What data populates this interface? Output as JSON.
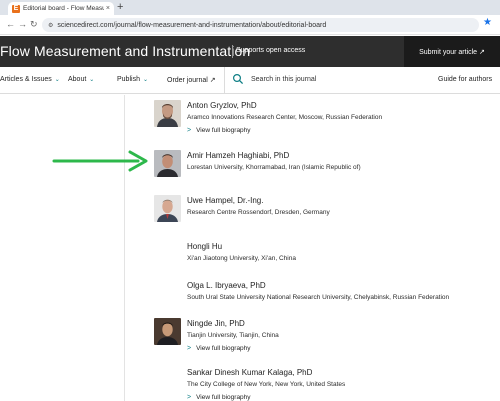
{
  "browser": {
    "tab_title": "Editorial board - Flow Measure",
    "tab_favicon_letter": "E",
    "tab_close": "×",
    "new_tab": "+",
    "back": "←",
    "forward": "→",
    "reload": "↻",
    "url": "sciencedirect.com/journal/flow-measurement-and-instrumentation/about/editorial-board",
    "accent_color": "#1a73e8"
  },
  "journal": {
    "title": "Flow Measurement and Instrumentation",
    "open_access": "Supports open access",
    "submit": "Submit your article ↗"
  },
  "nav": {
    "articles": "Articles & Issues",
    "about": "About",
    "publish": "Publish",
    "order": "Order journal ↗",
    "search_placeholder": "Search in this journal",
    "guide": "Guide for authors",
    "accent_color": "#0c7d84"
  },
  "members": [
    {
      "name": "Anton Gryzlov, PhD",
      "affiliation": "Aramco Innovations Research Center, Moscow, Russian Federation",
      "bio": "View full biography",
      "photo": "headshot"
    },
    {
      "name": "Amir Hamzeh Haghiabi, PhD",
      "affiliation": "Lorestan University, Khorramabad, Iran (Islamic Republic of)",
      "bio": "",
      "photo": "headshot"
    },
    {
      "name": "Uwe Hampel, Dr.-Ing.",
      "affiliation": "Research Centre Rossendorf, Dresden, Germany",
      "bio": "",
      "photo": "headshot"
    },
    {
      "name": "Hongli Hu",
      "affiliation": "Xi'an Jiaotong University, Xi'an, China",
      "bio": "",
      "photo": ""
    },
    {
      "name": "Olga L. Ibryaeva, PhD",
      "affiliation": "South Ural State University National Research University, Chelyabinsk, Russian Federation",
      "bio": "",
      "photo": ""
    },
    {
      "name": "Ningde Jin, PhD",
      "affiliation": "Tianjin University, Tianjin, China",
      "bio": "View full biography",
      "photo": "headshot"
    },
    {
      "name": "Sankar Dinesh Kumar Kalaga, PhD",
      "affiliation": "The City College of New York, New York, United States",
      "bio": "View full biography",
      "photo": ""
    }
  ],
  "annotation": {
    "arrow_color": "#2db84b"
  }
}
